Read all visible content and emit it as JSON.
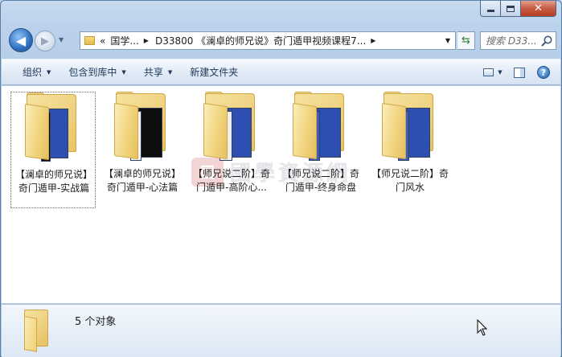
{
  "window": {
    "controls": {
      "minimize": "minimize-icon",
      "maximize": "maximize-icon",
      "close": "close-icon"
    }
  },
  "nav": {
    "breadcrumb_prefix": "«",
    "breadcrumb": [
      "国学...",
      "D33800 《澜卓的师兄说》奇门遁甲视频课程7..."
    ],
    "search_placeholder": "搜索 D33..."
  },
  "toolbar": {
    "organize": "组织",
    "include_in_library": "包含到库中",
    "share": "共享",
    "new_folder": "新建文件夹",
    "view_icon": "view-icon",
    "preview_pane_icon": "preview-pane-icon",
    "help_icon": "help-icon"
  },
  "watermark": {
    "logo_text": "国",
    "text": "國學資源網"
  },
  "items": [
    {
      "line1": "【澜卓的师兄说】",
      "line2": "奇门遁甲-实战篇",
      "doc_color": "#101010",
      "accent": "#2d4fb2"
    },
    {
      "line1": "【澜卓的师兄说】",
      "line2": "奇门遁甲-心法篇",
      "doc_color": "#f4f4f4",
      "accent": "#0e0e0e"
    },
    {
      "line1": "【师兄说二阶】奇",
      "line2": "门遁甲-高阶心...",
      "doc_color": "#eeeeee",
      "accent": "#2d4fb2"
    },
    {
      "line1": "【师兄说二阶】奇",
      "line2": "门遁甲-终身命盘",
      "doc_color": "#2d4fb2",
      "accent": "#2d4fb2"
    },
    {
      "line1": "【师兄说二阶】奇",
      "line2": "门风水",
      "doc_color": "#2d4fb2",
      "accent": "#2d4fb2"
    }
  ],
  "details": {
    "count": "5 个对象"
  }
}
